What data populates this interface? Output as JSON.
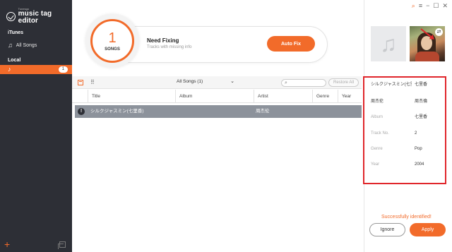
{
  "app": {
    "brand_small": "Tunesgo",
    "brand_name": "music tag editor"
  },
  "sidebar": {
    "sections": [
      {
        "label": "iTunes",
        "items": [
          {
            "label": "All Songs",
            "icon": "music-note-icon"
          }
        ]
      },
      {
        "label": "Local",
        "items": [
          {
            "label": "",
            "icon": "music-note-icon",
            "count": "1",
            "selected": true
          }
        ]
      }
    ],
    "add_icon": "+",
    "accent_color": "#f26b2a"
  },
  "window_controls": [
    "search-icon",
    "menu-icon",
    "minimize-icon",
    "maximize-icon",
    "close-icon"
  ],
  "fix_card": {
    "count": "1",
    "count_label": "SONGS",
    "title": "Need Fixing",
    "subtitle": "Tracks with missing info",
    "button": "Auto Fix"
  },
  "toolbar": {
    "filter_value": "All Songs (1)",
    "search_placeholder": "",
    "restore_label": "Restore All"
  },
  "table": {
    "columns": [
      "Title",
      "Album",
      "Artist",
      "Genre",
      "Year"
    ],
    "rows": [
      {
        "status": "!",
        "title": "シルクジャスミン(七里香)",
        "album": "",
        "artist": "周杰伦",
        "genre": "",
        "year": ""
      }
    ]
  },
  "details": {
    "fields": [
      {
        "key": "シルクジャスミン(七里",
        "value": "七里香",
        "style": "dark"
      },
      {
        "key": "周杰伦",
        "value": "周杰倫",
        "style": "dark"
      },
      {
        "key": "Album",
        "value": "七里香",
        "style": "muted"
      },
      {
        "key": "Track No.",
        "value": "2",
        "style": "muted"
      },
      {
        "key": "Genre",
        "value": "Pop",
        "style": "muted"
      },
      {
        "key": "Year",
        "value": "2004",
        "style": "muted"
      }
    ],
    "status": "Successfully identified!",
    "ignore_label": "Ignore",
    "apply_label": "Apply",
    "highlight_color": "#e0262b"
  }
}
